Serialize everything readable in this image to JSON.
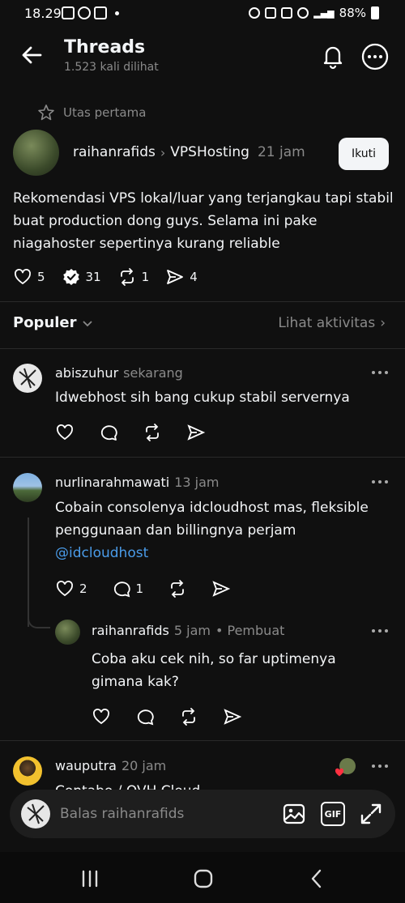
{
  "status_bar": {
    "time": "18.29",
    "battery": "88%"
  },
  "header": {
    "title": "Threads",
    "subtitle": "1.523 kali dilihat"
  },
  "first_thread_label": "Utas pertama",
  "main_post": {
    "author": "raihanrafids",
    "topic": "VPSHosting",
    "time": "21 jam",
    "follow_label": "Ikuti",
    "text": "Rekomendasi VPS lokal/luar yang terjangkau tapi stabil buat production dong guys. Selama ini pake niagahoster sepertinya kurang reliable",
    "likes": "5",
    "replies": "31",
    "reposts": "1",
    "shares": "4"
  },
  "sort": {
    "label": "Populer",
    "activity_link": "Lihat aktivitas"
  },
  "replies": [
    {
      "author": "abiszuhur",
      "time": "sekarang",
      "text": "Idwebhost sih bang cukup stabil servernya"
    },
    {
      "author": "nurlinarahmawati",
      "time": "13 jam",
      "text": "Cobain consolenya idcloudhost mas, fleksible penggunaan dan billingnya perjam",
      "mention": "@idcloudhost",
      "likes": "2",
      "replies": "1"
    },
    {
      "author": "raihanrafids",
      "time": "5 jam",
      "badge": "• Pembuat",
      "text": "Coba aku cek nih, so far uptimenya gimana kak?"
    },
    {
      "author": "wauputra",
      "time": "20 jam",
      "text": "Contabo / OVH Cloud"
    }
  ],
  "compose": {
    "placeholder": "Balas raihanrafids",
    "gif_label": "GIF"
  },
  "colors": {
    "background": "#101010",
    "text": "#f3f5f7",
    "muted": "#8a8a8a",
    "link": "#4a9be8"
  }
}
